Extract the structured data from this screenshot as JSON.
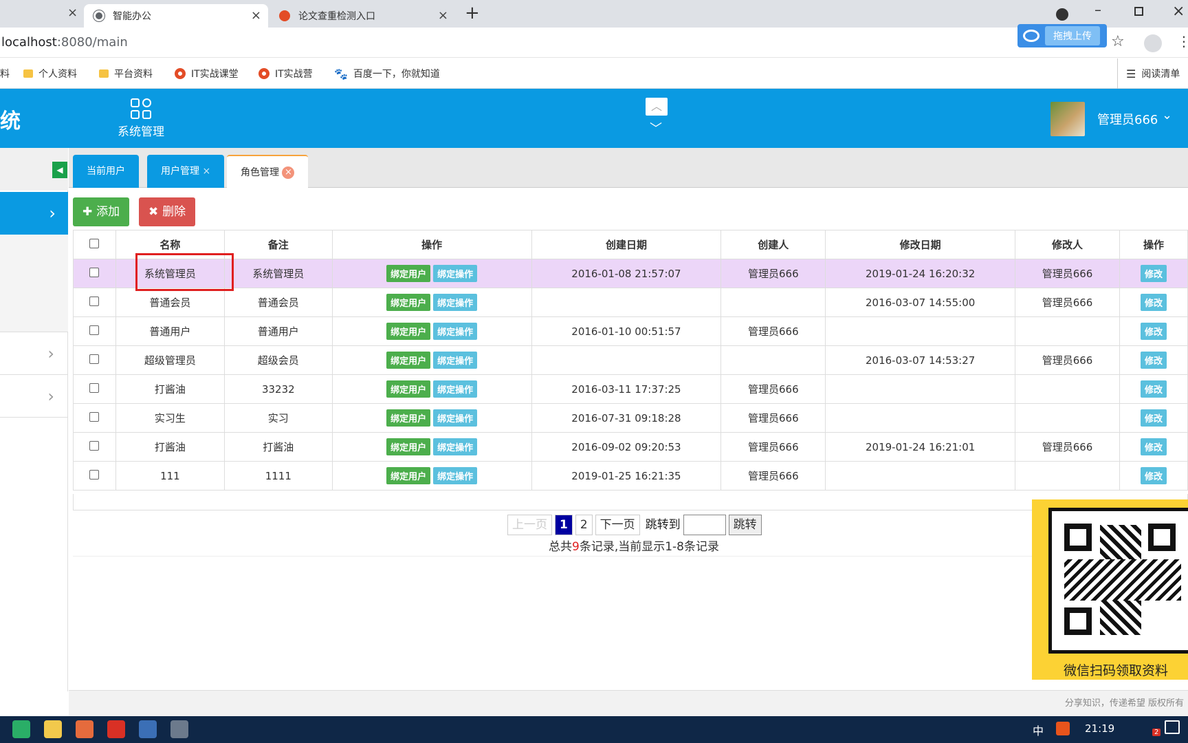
{
  "browser": {
    "tabs": [
      {
        "title": "智能办公",
        "close": "×"
      },
      {
        "title": "论文查重检测入口",
        "close": "×"
      }
    ],
    "new_tab": "+",
    "url_host": "localhost",
    "url_path": ":8080/main",
    "upload_label": "拖拽上传",
    "bookmarks": [
      "料",
      "个人资料",
      "平台资料",
      "IT实战课堂",
      "IT实战营",
      "百度一下，你就知道"
    ],
    "reading_list": "阅读清单"
  },
  "header": {
    "logo_fragment": "统",
    "nav_label": "系统管理",
    "user_name": "管理员666"
  },
  "page_tabs": [
    {
      "label": "当前用户"
    },
    {
      "label": "用户管理",
      "close": "×"
    },
    {
      "label": "角色管理"
    }
  ],
  "toolbar": {
    "add": "添加",
    "delete": "删除"
  },
  "table": {
    "headers": [
      "名称",
      "备注",
      "操作",
      "创建日期",
      "创建人",
      "修改日期",
      "修改人",
      "操作"
    ],
    "bind_user": "绑定用户",
    "bind_op": "绑定操作",
    "edit": "修改",
    "rows": [
      {
        "name": "系统管理员",
        "note": "系统管理员",
        "created": "2016-01-08 21:57:07",
        "creator": "管理员666",
        "modified": "2019-01-24 16:20:32",
        "modifier": "管理员666"
      },
      {
        "name": "普通会员",
        "note": "普通会员",
        "created": "",
        "creator": "",
        "modified": "2016-03-07 14:55:00",
        "modifier": "管理员666"
      },
      {
        "name": "普通用户",
        "note": "普通用户",
        "created": "2016-01-10 00:51:57",
        "creator": "管理员666",
        "modified": "",
        "modifier": ""
      },
      {
        "name": "超级管理员",
        "note": "超级会员",
        "created": "",
        "creator": "",
        "modified": "2016-03-07 14:53:27",
        "modifier": "管理员666"
      },
      {
        "name": "打酱油",
        "note": "33232",
        "created": "2016-03-11 17:37:25",
        "creator": "管理员666",
        "modified": "",
        "modifier": ""
      },
      {
        "name": "实习生",
        "note": "实习",
        "created": "2016-07-31 09:18:28",
        "creator": "管理员666",
        "modified": "",
        "modifier": ""
      },
      {
        "name": "打酱油",
        "note": "打酱油",
        "created": "2016-09-02 09:20:53",
        "creator": "管理员666",
        "modified": "2019-01-24 16:21:01",
        "modifier": "管理员666"
      },
      {
        "name": "111",
        "note": "1111",
        "created": "2019-01-25 16:21:35",
        "creator": "管理员666",
        "modified": "",
        "modifier": ""
      }
    ]
  },
  "pagination": {
    "prev": "上一页",
    "pages": [
      "1",
      "2"
    ],
    "current": "1",
    "next": "下一页",
    "jump_label": "跳转到",
    "jump_button": "跳转",
    "summary_prefix": "总共",
    "summary_total": "9",
    "summary_suffix": "条记录,当前显示1-8条记录"
  },
  "qr": {
    "caption": "微信扫码领取资料"
  },
  "footer": {
    "text": "分享知识，传递希望 版权所有"
  },
  "taskbar": {
    "time": "21:19",
    "ime": "中",
    "badge": "2"
  }
}
